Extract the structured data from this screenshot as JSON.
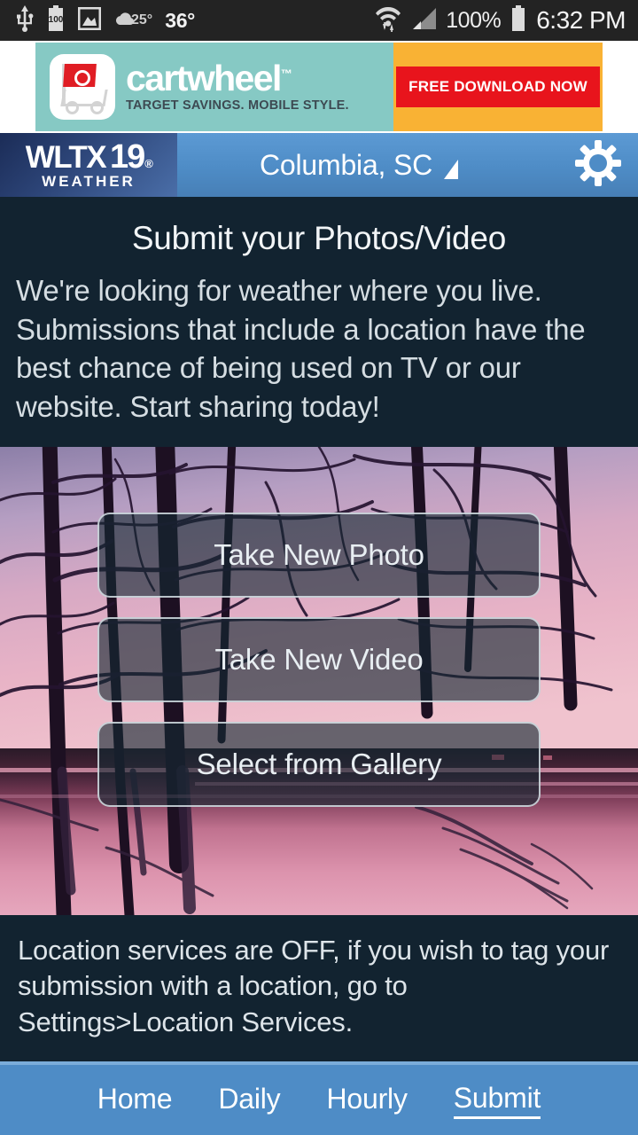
{
  "status_bar": {
    "icons": [
      "usb-icon",
      "battery-saver-100-icon",
      "image-icon",
      "cloud-weather-icon"
    ],
    "low_temp": "25°",
    "temperature": "36°",
    "right_icons": [
      "wifi-data-transfer-icon",
      "cellular-signal-icon",
      "battery-icon"
    ],
    "battery_percent": "100%",
    "clock": "6:32 PM"
  },
  "ad": {
    "brand": "cartwheel",
    "brand_tm": "™",
    "tagline": "TARGET SAVINGS. MOBILE STYLE.",
    "cta_label": "FREE DOWNLOAD NOW",
    "bg_left": "#86c9c4",
    "bg_right": "#f9b234",
    "cta_bg": "#e8141c"
  },
  "app_bar": {
    "brand_call_letters": "WLTX",
    "brand_channel": "19",
    "brand_registered": "®",
    "brand_sub": "WEATHER",
    "location": "Columbia, SC",
    "location_caret": "dropdown-caret-icon",
    "settings_icon": "gear-icon",
    "bg_color": "#4e8cc6"
  },
  "intro": {
    "title": "Submit your Photos/Video",
    "body": "We're looking for weather where you live. Submissions that include a location have the best chance of being used on TV or our website. Start sharing today!",
    "bg_color": "#122330"
  },
  "actions": {
    "take_photo": "Take New Photo",
    "take_video": "Take New Video",
    "select_gallery": "Select from Gallery"
  },
  "notice": {
    "text": "Location services are OFF, if you wish to tag your submission with a location, go to Settings>Location Services."
  },
  "bottom_nav": {
    "items": [
      {
        "label": "Home",
        "active": false
      },
      {
        "label": "Daily",
        "active": false
      },
      {
        "label": "Hourly",
        "active": false
      },
      {
        "label": "Submit",
        "active": true
      }
    ]
  }
}
